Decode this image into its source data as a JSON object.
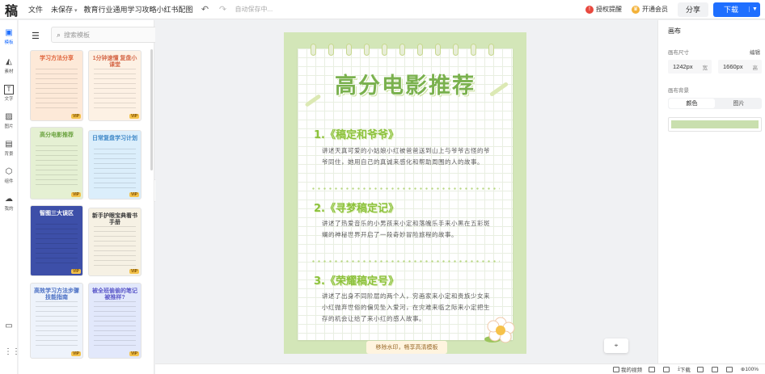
{
  "header": {
    "logo": "稿",
    "menu_file": "文件",
    "save_state": "未保存",
    "doc_title": "教育行业通用学习攻略小红书配图",
    "autosave": "自动保存中...",
    "license": "授权提醒",
    "vip": "开通会员",
    "share": "分享",
    "download": "下载"
  },
  "rail": {
    "items": [
      {
        "icon": "template-icon",
        "label": "模板"
      },
      {
        "icon": "shapes-icon",
        "label": "素材"
      },
      {
        "icon": "text-icon",
        "label": "文字"
      },
      {
        "icon": "image-icon",
        "label": "图片"
      },
      {
        "icon": "background-icon",
        "label": "背景"
      },
      {
        "icon": "component-icon",
        "label": "组件"
      },
      {
        "icon": "upload-icon",
        "label": "我的"
      }
    ]
  },
  "templates": {
    "search_placeholder": "搜索模板",
    "vip_badge": "VIP",
    "cards": [
      {
        "title": "学习方法分享",
        "bg": "#fde9d8",
        "accent": "#e0643c"
      },
      {
        "title": "1分钟速懂 复盘小课堂",
        "bg": "#fdf1e4",
        "accent": "#d66a4a"
      },
      {
        "title": "高分电影推荐",
        "bg": "#e5f0d3",
        "accent": "#6aa23e"
      },
      {
        "title": "日常复盘学习计划",
        "bg": "#dbeefb",
        "accent": "#3f88c8"
      },
      {
        "title": "智图三大误区",
        "bg": "#3d4fa8",
        "accent": "#ffffff"
      },
      {
        "title": "新手护眼宝典看书手册",
        "bg": "#f6f1e4",
        "accent": "#3b3b3b"
      },
      {
        "title": "高效学习方法步骤技能指南",
        "bg": "#eef3fb",
        "accent": "#4a6fc4"
      },
      {
        "title": "被全班偷偷的笔记被推样?",
        "bg": "#e2e8fb",
        "accent": "#5b58c9"
      }
    ]
  },
  "poster": {
    "title": "高分电影推荐",
    "sections": [
      {
        "title": "1.《稿定和爷爷》",
        "body": "讲述天真可爱的小姑娘小红被爸爸送到山上与爷爷古怪的爷爷同住，她用自己的真诚来感化和帮助周围的人的故事。"
      },
      {
        "title": "2.《寻梦稿定记》",
        "body": "讲述了热爱音乐的小男孩来小定和落魄乐手来小黑在五彩斑斓的神秘世界开启了一段奇妙冒险旅程的故事。"
      },
      {
        "title": "3.《荣耀稿定号》",
        "body": "讲述了出身不同阶层的两个人，穷画家来小定和贵族少女来小红抛弃世俗的偏见坠入爱河，在灾难来临之际来小定把生存的机会让给了来小红的感人故事。"
      }
    ],
    "watermark_banner": "移除水印，畅享高清模板",
    "colors": {
      "bg": "#d3e6b8",
      "title": "#7ab14e",
      "section": "#8cc23c"
    }
  },
  "properties": {
    "title": "画布",
    "size_label": "画布尺寸",
    "edit": "编辑",
    "width": "1242px",
    "width_unit": "宽",
    "height": "1660px",
    "height_unit": "高",
    "bg_label": "画布背景",
    "tab_color": "颜色",
    "tab_image": "图片",
    "bg_color": "#c9dfae"
  },
  "statusbar": {
    "tutorial": "我的视频",
    "download": "下载",
    "zoom": "100%"
  }
}
